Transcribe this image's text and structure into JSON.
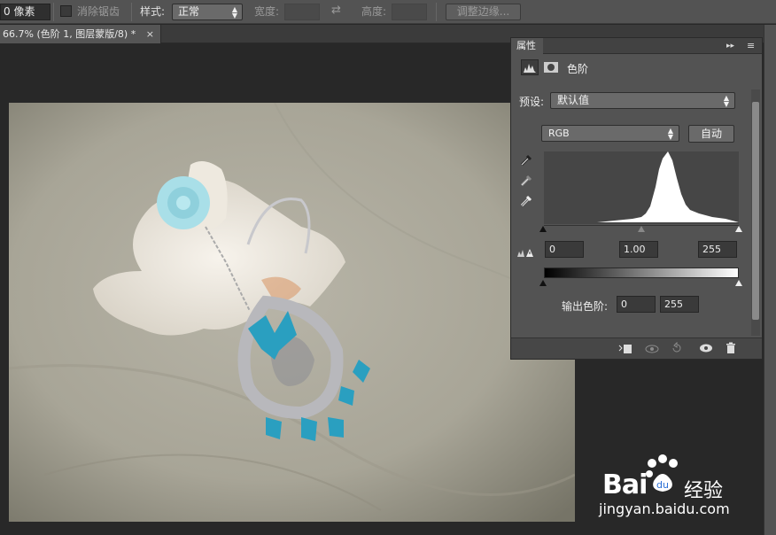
{
  "options_bar": {
    "feather_value": "0 像素",
    "anti_alias_label": "消除锯齿",
    "style_label": "样式:",
    "style_value": "正常",
    "width_label": "宽度:",
    "height_label": "高度:",
    "refine_edge_label": "调整边缘..."
  },
  "document_tab": {
    "title": "66.7% (色阶 1, 图层蒙版/8) *",
    "close": "×"
  },
  "properties_panel": {
    "tab_label": "属性",
    "collapse_icon": "▸▸",
    "menu_icon": "≡",
    "adjustment_title": "色阶",
    "preset_label": "预设:",
    "preset_value": "默认值",
    "channel_value": "RGB",
    "auto_button": "自动",
    "input_black": "0",
    "input_gamma": "1.00",
    "input_white": "255",
    "output_label": "输出色阶:",
    "output_black": "0",
    "output_white": "255"
  },
  "watermark": {
    "brand": "Bai",
    "brand_suffix": "du",
    "product": "经验",
    "url": "jingyan.baidu.com"
  },
  "colors": {
    "panel_bg": "#535353",
    "canvas_bg": "#282828",
    "bead_color": "#2a9fc0"
  }
}
